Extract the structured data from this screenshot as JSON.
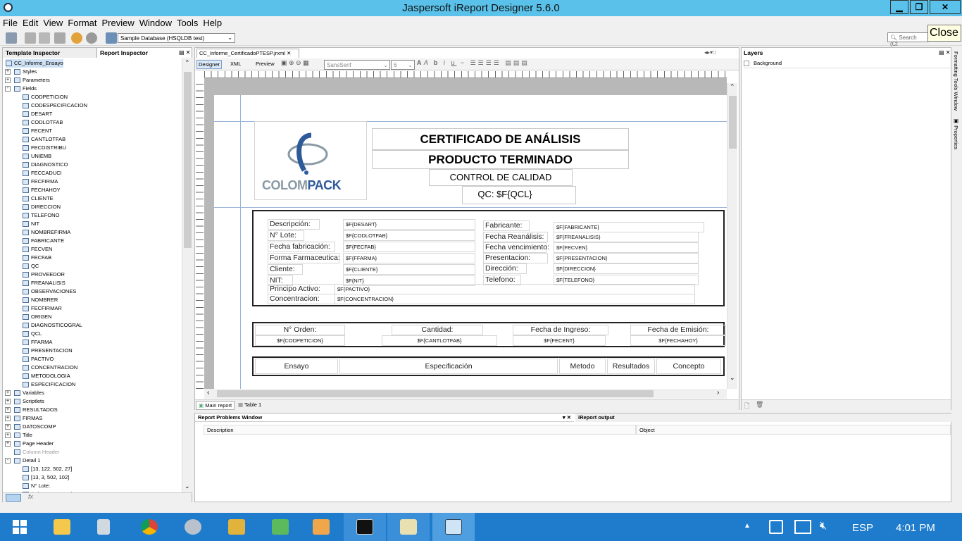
{
  "window": {
    "title": "Jaspersoft iReport Designer 5.6.0",
    "tooltip": "Close"
  },
  "menu": [
    "File",
    "Edit",
    "View",
    "Format",
    "Preview",
    "Window",
    "Tools",
    "Help"
  ],
  "toolbar": {
    "datasource": "Sample Database (HSQLDB test)",
    "search_placeholder": "Search (Ct"
  },
  "left_tabs": [
    "Template Inspector",
    "Report Inspector"
  ],
  "tree": {
    "root": "CC_Informe_Ensayo",
    "top": [
      "Styles",
      "Parameters",
      "Fields"
    ],
    "fields": [
      "CODPETICION",
      "CODESPECIFICACION",
      "DESART",
      "CODLOTFAB",
      "FECENT",
      "CANTLOTFAB",
      "FECDISTRIBU",
      "UNIEMB",
      "DIAGNOSTICO",
      "FECCADUCI",
      "FECFIRMA",
      "FECHAHOY",
      "CLIENTE",
      "DIRECCION",
      "TELEFONO",
      "NIT",
      "NOMBREFIRMA",
      "FABRICANTE",
      "FECVEN",
      "FECFAB",
      "QC",
      "PROVEEDOR",
      "FREANALISIS",
      "OBSERVACIONES",
      "NOMBRER",
      "FECFIRMAR",
      "ORIGEN",
      "DIAGNOSTICOGRAL",
      "QCL",
      "FFARMA",
      "PRESENTACION",
      "PACTIVO",
      "CONCENTRACION",
      "METODOLOGIA",
      "ESPECIFICACION"
    ],
    "after": [
      "Variables",
      "Scriptlets",
      "RESULTADOS",
      "FIRMAS",
      "DATOSCOMP",
      "Title",
      "Page Header",
      "Column Header",
      "Detail 1"
    ],
    "detail": [
      "[13, 122, 502, 27]",
      "[13, 3, 502, 102]",
      "N° Lote:",
      "$F{CODLOTFAB}"
    ]
  },
  "editor": {
    "tab": "CC_Informe_CertificadoPTESP.jrxml",
    "modes": [
      "Designer",
      "XML",
      "Preview"
    ],
    "font": "SansSerif",
    "size": "6",
    "bottom_tabs": [
      "Main report",
      "Table 1"
    ]
  },
  "report": {
    "logo_a": "COLOM",
    "logo_b": "PACK",
    "title1": "CERTIFICADO DE ANÁLISIS",
    "title2": "PRODUCTO TERMINADO",
    "title3": "CONTROL DE CALIDAD",
    "qc": "QC: $F{QCL}",
    "left_labels": [
      "Descripción:",
      "N° Lote:",
      "Fecha fabricación:",
      "Forma Farmaceutica:",
      "Cliente:",
      "NIT:"
    ],
    "left_fields": [
      "$F{DESART}",
      "$F{CODLOTFAB}",
      "$F{FECFAB}",
      "$F{FFARMA}",
      "$F{CLIENTE}",
      "$F{NIT}"
    ],
    "right_labels": [
      "Fabricante:",
      "Fecha Reanálisis:",
      "Fecha vencimiento:",
      "Presentacion:",
      "Dirección:",
      "Telefono:"
    ],
    "right_fields": [
      "$F{FABRICANTE}",
      "$F{FREANALISIS}",
      "$F{FECVEN}",
      "$F{PRESENTACION}",
      "$F{DIRECCION}",
      "$F{TELEFONO}"
    ],
    "pa_label": "Principo Activo:",
    "pa_field": "$F{PACTIVO}",
    "conc_label": "Concentracion:",
    "conc_field": "$F{CONCENTRACION}",
    "order_headers": [
      "N° Orden:",
      "Cantidad:",
      "Fecha de Ingreso:",
      "Fecha de Emisión:"
    ],
    "order_fields": [
      "$F{CODPETICION}",
      "$F{CANTLOTFAB}",
      "$F{FECENT}",
      "$F{FECHAHOY}"
    ],
    "table_headers": [
      "Ensayo",
      "Especificación",
      "Metodo",
      "Resultados",
      "Concepto"
    ]
  },
  "layers": {
    "title": "Layers",
    "items": [
      "Background"
    ]
  },
  "right_strip": [
    "Formatting Tools Window",
    "Properties"
  ],
  "problems": {
    "tabs": [
      "Report Problems Window",
      "iReport output"
    ],
    "columns": [
      "Description",
      "Object"
    ]
  },
  "taskbar": {
    "lang": "ESP",
    "time": "4:01 PM"
  }
}
